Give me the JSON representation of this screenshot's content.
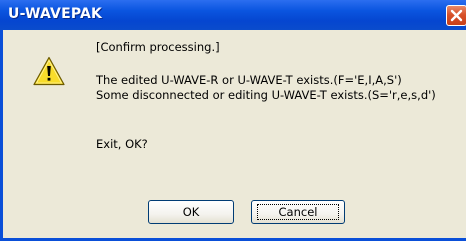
{
  "window": {
    "title": "U-WAVEPAK",
    "close_glyph": "✕"
  },
  "dialog": {
    "icon": "warning-icon",
    "header": "[Confirm processing.]",
    "line1": "The edited U-WAVE-R or U-WAVE-T exists.(F='E,I,A,S')",
    "line2": "Some disconnected or editing U-WAVE-T exists.(S='r,e,s,d')",
    "question": "Exit, OK?"
  },
  "buttons": {
    "ok_label": "OK",
    "cancel_label": "Cancel"
  },
  "colors": {
    "titlebar": "#0546d0",
    "client": "#ece9d8",
    "close": "#d8522a"
  }
}
